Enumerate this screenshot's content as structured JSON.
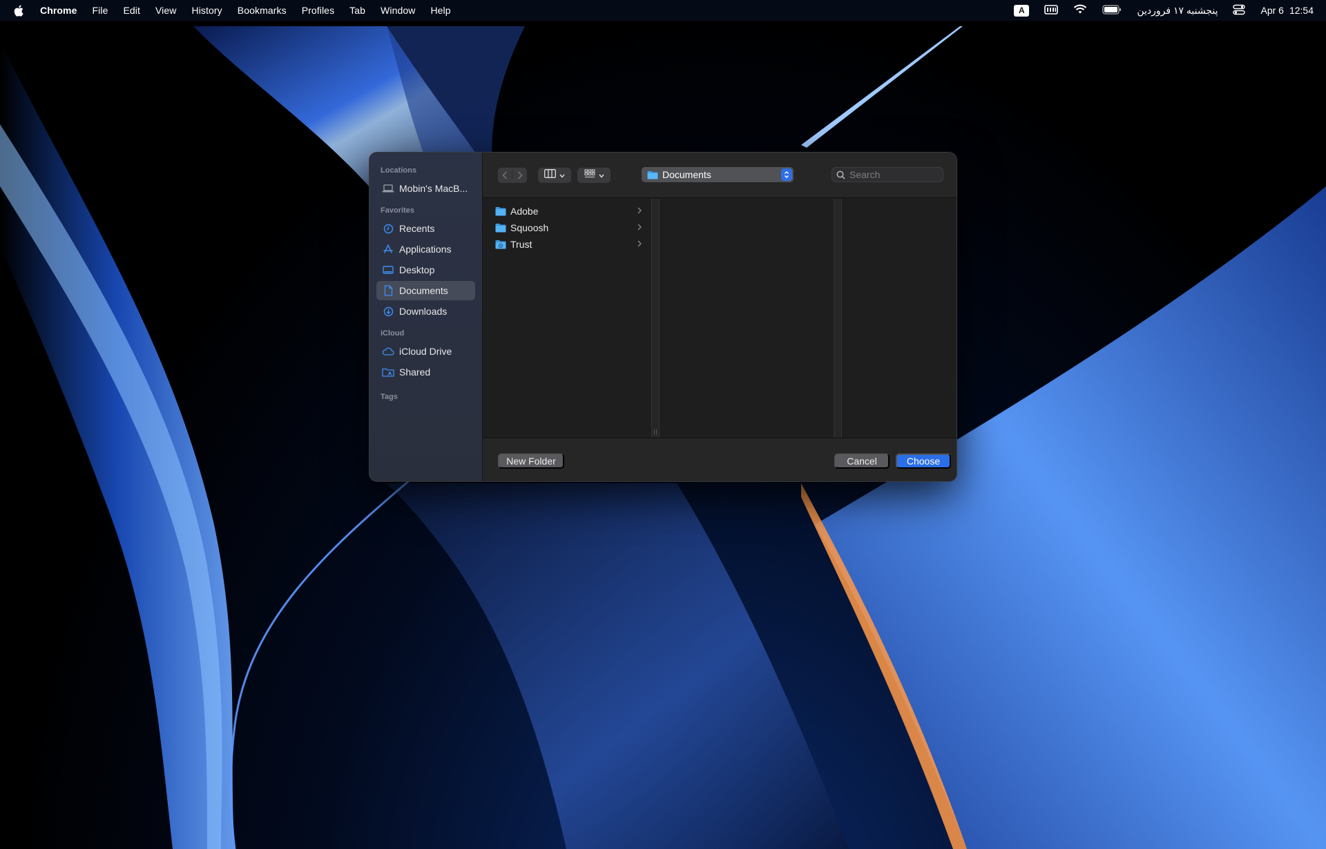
{
  "menubar": {
    "app_name": "Chrome",
    "items": [
      "File",
      "Edit",
      "View",
      "History",
      "Bookmarks",
      "Profiles",
      "Tab",
      "Window",
      "Help"
    ],
    "input_badge": "A",
    "date_persian": "پنجشنبه ۱۷ فروردین",
    "date": "Apr 6",
    "time": "12:54"
  },
  "sidebar": {
    "sections": {
      "locations": "Locations",
      "favorites": "Favorites",
      "icloud": "iCloud",
      "tags": "Tags"
    },
    "locations": [
      {
        "label": "Mobin's MacB...",
        "icon": "laptop-icon"
      }
    ],
    "favorites": [
      {
        "label": "Recents",
        "icon": "clock-icon"
      },
      {
        "label": "Applications",
        "icon": "applications-icon"
      },
      {
        "label": "Desktop",
        "icon": "desktop-icon"
      },
      {
        "label": "Documents",
        "icon": "document-icon",
        "selected": true
      },
      {
        "label": "Downloads",
        "icon": "download-icon"
      }
    ],
    "icloud": [
      {
        "label": "iCloud Drive",
        "icon": "cloud-icon"
      },
      {
        "label": "Shared",
        "icon": "shared-folder-icon"
      }
    ]
  },
  "toolbar": {
    "path": "Documents",
    "search_placeholder": "Search"
  },
  "files": [
    {
      "name": "Adobe",
      "icon": "folder-icon"
    },
    {
      "name": "Squoosh",
      "icon": "folder-icon"
    },
    {
      "name": "Trust",
      "icon": "special-folder-icon"
    }
  ],
  "footer": {
    "new_folder": "New Folder",
    "cancel": "Cancel",
    "choose": "Choose"
  },
  "colors": {
    "accent": "#2a6ee8",
    "folder": "#3fa3f0",
    "sidebar_icon": "#3d8ef5"
  }
}
